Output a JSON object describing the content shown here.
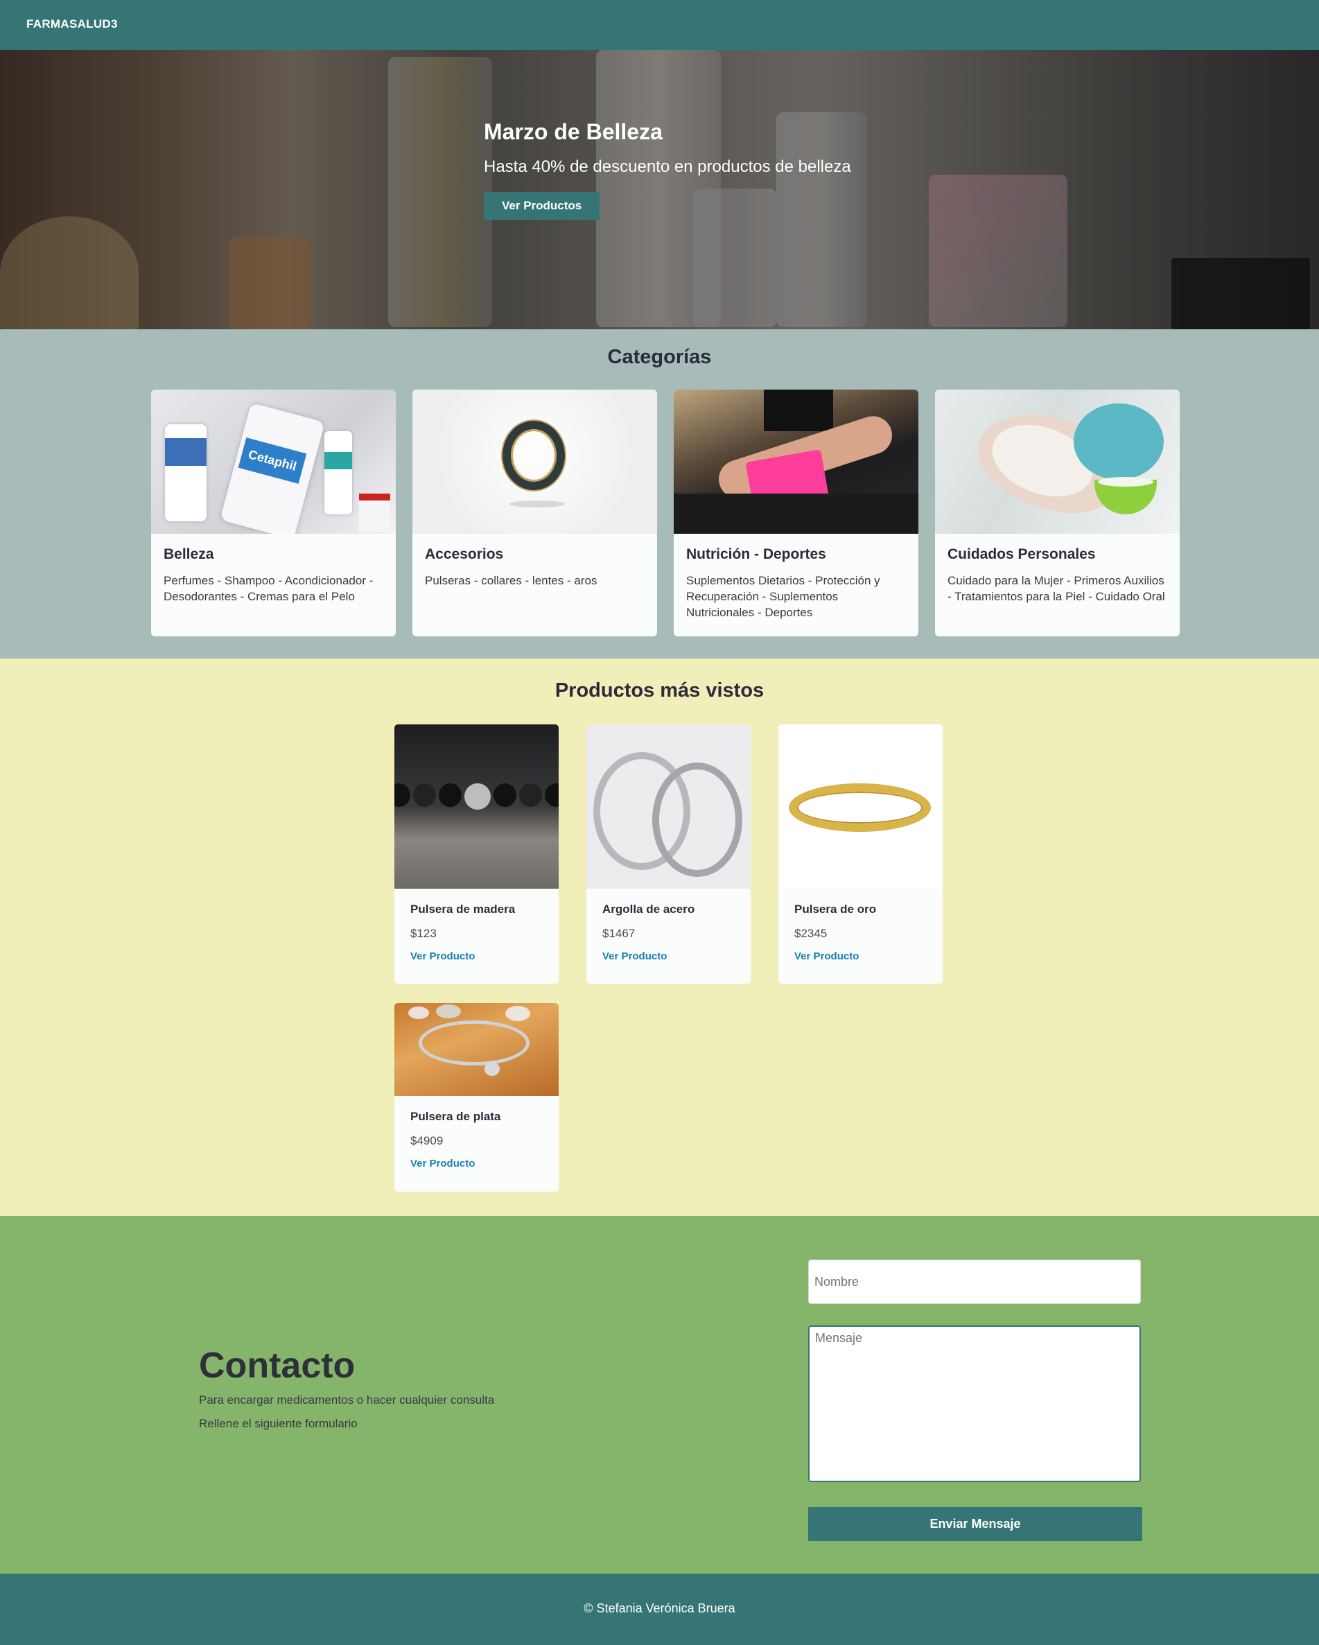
{
  "navbar": {
    "brand": "FARMASALUD3"
  },
  "hero": {
    "title": "Marzo de Belleza",
    "subtitle": "Hasta 40% de descuento en productos de belleza",
    "button_label": "Ver Productos"
  },
  "categories": {
    "title": "Categorías",
    "items": [
      {
        "title": "Belleza",
        "text": "Perfumes - Shampoo - Acondicionador - Desodorantes - Cremas para el Pelo",
        "image_label": "Cetaphil"
      },
      {
        "title": "Accesorios",
        "text": "Pulseras - collares - lentes - aros"
      },
      {
        "title": "Nutrición - Deportes",
        "text": "Suplementos Dietarios - Protección y Recuperación - Suplementos Nutricionales - Deportes"
      },
      {
        "title": "Cuidados Personales",
        "text": "Cuidado para la Mujer - Primeros Auxilios - Tratamientos para la Piel - Cuidado Oral"
      }
    ]
  },
  "products": {
    "title": "Productos más vistos",
    "items": [
      {
        "name": "Pulsera de madera",
        "price": "$123",
        "link": "Ver Producto"
      },
      {
        "name": "Argolla de acero",
        "price": "$1467",
        "link": "Ver Producto"
      },
      {
        "name": "Pulsera de oro",
        "price": "$2345",
        "link": "Ver Producto"
      },
      {
        "name": "Pulsera de plata",
        "price": "$4909",
        "link": "Ver Producto"
      }
    ]
  },
  "contact": {
    "title": "Contacto",
    "line1": "Para encargar medicamentos o hacer cualquier consulta",
    "line2": "Rellene el siguiente formulario",
    "name_placeholder": "Nombre",
    "message_placeholder": "Mensaje",
    "submit_label": "Enviar Mensaje"
  },
  "footer": {
    "text": "© Stefania Verónica Bruera"
  },
  "colors": {
    "primary": "#357575",
    "categories_bg": "#a7bcb9",
    "products_bg": "#f0eeb9",
    "contact_bg": "#84b56b",
    "link": "#1a7fb5"
  }
}
